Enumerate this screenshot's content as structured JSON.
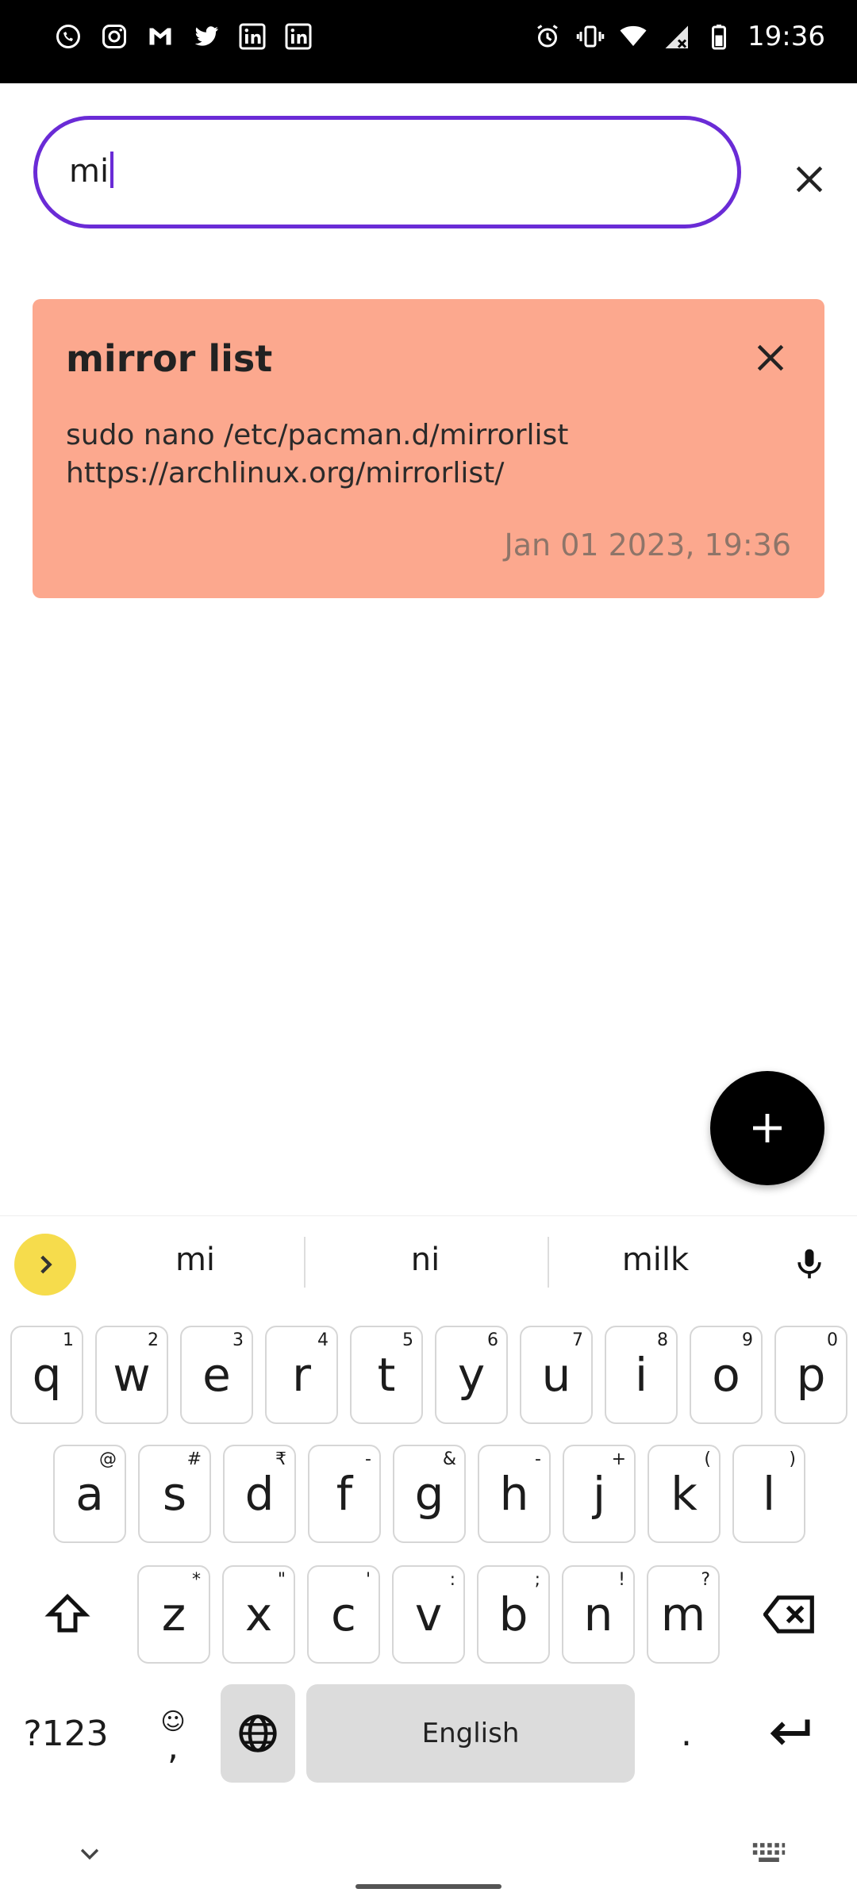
{
  "status_bar": {
    "time": "19:36",
    "left_icons": [
      "whatsapp-icon",
      "instagram-icon",
      "gmail-icon",
      "twitter-icon",
      "linkedin-icon",
      "linkedin-icon"
    ],
    "right_icons": [
      "alarm-icon",
      "vibrate-icon",
      "wifi-icon",
      "no-signal-icon",
      "battery-icon"
    ]
  },
  "search": {
    "value": "mi"
  },
  "note": {
    "title": "mirror list",
    "body_line1": "sudo nano /etc/pacman.d/mirrorlist",
    "body_line2": "https://archlinux.org/mirrorlist/",
    "date": "Jan 01 2023, 19:36",
    "color": "#fca88e"
  },
  "fab": {
    "icon": "plus-icon"
  },
  "keyboard": {
    "suggestions": [
      "mi",
      "ni",
      "milk"
    ],
    "row1": [
      {
        "k": "q",
        "h": "1"
      },
      {
        "k": "w",
        "h": "2"
      },
      {
        "k": "e",
        "h": "3"
      },
      {
        "k": "r",
        "h": "4"
      },
      {
        "k": "t",
        "h": "5"
      },
      {
        "k": "y",
        "h": "6"
      },
      {
        "k": "u",
        "h": "7"
      },
      {
        "k": "i",
        "h": "8"
      },
      {
        "k": "o",
        "h": "9"
      },
      {
        "k": "p",
        "h": "0"
      }
    ],
    "row2": [
      {
        "k": "a",
        "h": "@"
      },
      {
        "k": "s",
        "h": "#"
      },
      {
        "k": "d",
        "h": "₹"
      },
      {
        "k": "f",
        "h": "-"
      },
      {
        "k": "g",
        "h": "&"
      },
      {
        "k": "h",
        "h": "-"
      },
      {
        "k": "j",
        "h": "+"
      },
      {
        "k": "k",
        "h": "("
      },
      {
        "k": "l",
        "h": ")"
      }
    ],
    "row3": [
      {
        "k": "z",
        "h": "*"
      },
      {
        "k": "x",
        "h": "\""
      },
      {
        "k": "c",
        "h": "'"
      },
      {
        "k": "v",
        "h": ":"
      },
      {
        "k": "b",
        "h": ";"
      },
      {
        "k": "n",
        "h": "!"
      },
      {
        "k": "m",
        "h": "?"
      }
    ],
    "symbols_label": "?123",
    "comma_label": ",",
    "space_label": "English",
    "period_label": "."
  }
}
